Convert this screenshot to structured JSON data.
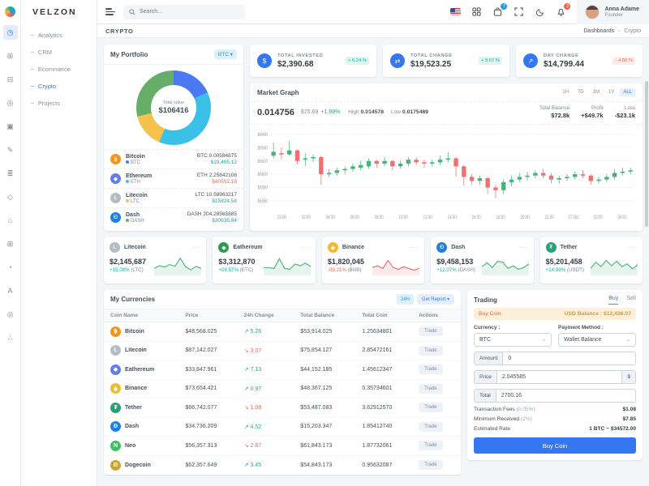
{
  "brand": {
    "name": "VELZON"
  },
  "topbar": {
    "search_placeholder": "Search...",
    "cart_badge": "7",
    "bell_badge": "3",
    "user": {
      "name": "Anna Adame",
      "role": "Founder"
    }
  },
  "sidebar": {
    "rail_icons": [
      {
        "name": "dashboards-icon",
        "glyph": "◷",
        "active": true
      },
      {
        "name": "apps-icon",
        "glyph": "⊞",
        "active": false
      },
      {
        "name": "layouts-icon",
        "glyph": "⊟",
        "active": false
      },
      {
        "name": "authentication-icon",
        "glyph": "◎",
        "active": false
      },
      {
        "name": "pages-icon",
        "glyph": "▣",
        "active": false
      },
      {
        "name": "forms-icon",
        "glyph": "✎",
        "active": false
      },
      {
        "name": "components-icon",
        "glyph": "≣",
        "active": false
      },
      {
        "name": "security-icon",
        "glyph": "◇",
        "active": false
      },
      {
        "name": "landing-icon",
        "glyph": "⌂",
        "active": false
      },
      {
        "name": "tables-icon",
        "glyph": "⊞",
        "active": false
      },
      {
        "name": "charts-icon",
        "glyph": "◔",
        "active": false
      },
      {
        "name": "typography-icon",
        "glyph": "A",
        "active": false
      },
      {
        "name": "settings-icon",
        "glyph": "◎",
        "active": false
      },
      {
        "name": "share-icon",
        "glyph": "∴",
        "active": false
      }
    ],
    "items": [
      {
        "label": "Analytics",
        "active": false
      },
      {
        "label": "CRM",
        "active": false
      },
      {
        "label": "Ecommerce",
        "active": false
      },
      {
        "label": "Crypto",
        "active": true
      },
      {
        "label": "Projects",
        "active": false
      }
    ]
  },
  "breadcrumb": {
    "title": "CRYPTO",
    "path": [
      "Dashboards",
      "Crypto"
    ]
  },
  "portfolio": {
    "title": "My Portfolio",
    "currency_selector": "BTC",
    "total_label": "Total value",
    "total_value": "$106416",
    "donut": {
      "colors": [
        "#4b79f1",
        "#3bc0e8",
        "#f7c24b",
        "#66ad68"
      ],
      "segments": [
        {
          "name": "Bitcoin",
          "pct": 18.2
        },
        {
          "name": "Ethereum",
          "pct": 38.1
        },
        {
          "name": "Litecoin",
          "pct": 14.9
        },
        {
          "name": "Dash",
          "pct": 28.8
        }
      ]
    },
    "coins": [
      {
        "name": "Bitcoin",
        "ticker": "BTC",
        "amount": "BTC 0.00584875",
        "value": "$19,405.12",
        "dir": "up",
        "icon": "฿",
        "icon_color": "#f7931a",
        "dot": "#4b79f1"
      },
      {
        "name": "Ethereum",
        "ticker": "ETH",
        "amount": "ETH 2.25842108",
        "value": "$40552.18",
        "dir": "down",
        "icon": "◆",
        "icon_color": "#627eea",
        "dot": "#3bc0e8"
      },
      {
        "name": "Litecoin",
        "ticker": "LTC",
        "amount": "LTC 10.58963217",
        "value": "$15824.58",
        "dir": "up",
        "icon": "Ł",
        "icon_color": "#b5bdc4",
        "dot": "#f7c24b"
      },
      {
        "name": "Dash",
        "ticker": "DASH",
        "amount": "DASH 204.28565885",
        "value": "$30635.84",
        "dir": "up",
        "icon": "Đ",
        "icon_color": "#1f7fe0",
        "dot": "#66ad68"
      }
    ]
  },
  "stats": [
    {
      "label": "TOTAL INVESTED",
      "value": "$2,390.68",
      "change": "+ 6.24 %",
      "dir": "up",
      "icon": "$"
    },
    {
      "label": "TOTAL CHANGE",
      "value": "$19,523.25",
      "change": "+ 3.67 %",
      "dir": "up",
      "icon": "⇄"
    },
    {
      "label": "DAY CHANGE",
      "value": "$14,799.44",
      "change": "- 4.80 %",
      "dir": "down",
      "icon": "↗"
    }
  ],
  "market": {
    "title": "Market Graph",
    "ranges": [
      "1H",
      "7D",
      "1M",
      "1Y",
      "ALL"
    ],
    "active_range": "ALL",
    "price": "0.014756",
    "usd": "$75.69",
    "change": "+1.99%",
    "high_label": "High",
    "high": "0.014578",
    "low_label": "Low",
    "low": "0.0175489",
    "total_balance_label": "Total Balance",
    "total_balance": "$72.8k",
    "profit_label": "Profit",
    "profit": "+$49.7k",
    "loss_label": "Loss",
    "loss": "-$23.1k"
  },
  "chart_data": {
    "type": "candlestick",
    "title": "Market Graph",
    "up_color": "#45b37a",
    "down_color": "#f07070",
    "ylim": [
      6550,
      6665
    ],
    "y_ticks": [
      6660,
      6640,
      6620,
      6600,
      6580,
      6560
    ],
    "y_tick_labels": [
      "$6660",
      "$6640",
      "$6620",
      "$6600",
      "$6580",
      "$6560"
    ],
    "x_ticks": [
      "23:00",
      "02:00",
      "04:00",
      "06:00",
      "08:00",
      "10:00",
      "12:00",
      "14:00",
      "16:00",
      "18:00",
      "20:00",
      "22:00",
      "07 Oct",
      "02:00",
      "04:00"
    ],
    "candles_ohlc": [
      [
        6628,
        6648,
        6624,
        6634
      ],
      [
        6632,
        6640,
        6622,
        6630
      ],
      [
        6630,
        6650,
        6628,
        6636
      ],
      [
        6636,
        6638,
        6615,
        6620
      ],
      [
        6622,
        6632,
        6612,
        6624
      ],
      [
        6624,
        6630,
        6618,
        6626
      ],
      [
        6626,
        6628,
        6584,
        6600
      ],
      [
        6600,
        6608,
        6596,
        6602
      ],
      [
        6602,
        6610,
        6598,
        6606
      ],
      [
        6606,
        6612,
        6600,
        6608
      ],
      [
        6608,
        6616,
        6604,
        6612
      ],
      [
        6610,
        6620,
        6606,
        6614
      ],
      [
        6612,
        6624,
        6608,
        6620
      ],
      [
        6620,
        6622,
        6610,
        6616
      ],
      [
        6616,
        6626,
        6612,
        6620
      ],
      [
        6620,
        6622,
        6606,
        6612
      ],
      [
        6612,
        6620,
        6608,
        6616
      ],
      [
        6616,
        6626,
        6612,
        6622
      ],
      [
        6622,
        6626,
        6614,
        6618
      ],
      [
        6618,
        6622,
        6610,
        6616
      ],
      [
        6616,
        6622,
        6612,
        6618
      ],
      [
        6618,
        6628,
        6614,
        6622
      ],
      [
        6622,
        6634,
        6618,
        6624
      ],
      [
        6624,
        6626,
        6596,
        6612
      ],
      [
        6612,
        6614,
        6582,
        6596
      ],
      [
        6596,
        6600,
        6584,
        6590
      ],
      [
        6590,
        6598,
        6584,
        6594
      ],
      [
        6594,
        6596,
        6570,
        6580
      ],
      [
        6580,
        6584,
        6564,
        6576
      ],
      [
        6576,
        6592,
        6570,
        6588
      ],
      [
        6588,
        6598,
        6582,
        6592
      ],
      [
        6592,
        6602,
        6588,
        6596
      ],
      [
        6596,
        6604,
        6590,
        6598
      ],
      [
        6598,
        6606,
        6594,
        6602
      ],
      [
        6602,
        6608,
        6594,
        6598
      ],
      [
        6598,
        6602,
        6586,
        6592
      ],
      [
        6592,
        6598,
        6586,
        6594
      ],
      [
        6594,
        6600,
        6590,
        6596
      ],
      [
        6596,
        6604,
        6592,
        6600
      ],
      [
        6600,
        6606,
        6594,
        6598
      ],
      [
        6598,
        6600,
        6584,
        6590
      ],
      [
        6590,
        6596,
        6586,
        6592
      ],
      [
        6592,
        6600,
        6588,
        6596
      ],
      [
        6596,
        6608,
        6592,
        6602
      ],
      [
        6602,
        6610,
        6598,
        6604
      ],
      [
        6604,
        6610,
        6600,
        6606
      ]
    ]
  },
  "coin_cards": [
    {
      "name": "Litecoin",
      "value": "$2,145,687",
      "change": "+15.08%",
      "ticker": "(LTC)",
      "dir": "up",
      "icon": "Ł",
      "icon_color": "#b5bdc4",
      "spark": [
        30,
        45,
        38,
        52,
        42,
        88,
        40,
        22,
        42,
        30
      ]
    },
    {
      "name": "Eathereum",
      "value": "$3,312,870",
      "change": "+08.57%",
      "ticker": "(ETC)",
      "dir": "up",
      "icon": "◆",
      "icon_color": "#2d9a4f",
      "spark": [
        35,
        35,
        30,
        85,
        30,
        25,
        55,
        45,
        60,
        40
      ]
    },
    {
      "name": "Binance",
      "value": "$1,820,045",
      "change": "-09.21%",
      "ticker": "(BNB)",
      "dir": "down",
      "icon": "◆",
      "icon_color": "#f3ba2f",
      "spark": [
        35,
        45,
        30,
        75,
        35,
        25,
        40,
        30,
        20,
        32
      ]
    },
    {
      "name": "Dash",
      "value": "$9,458,153",
      "change": "+12.07%",
      "ticker": "(DASH)",
      "dir": "up",
      "icon": "Đ",
      "icon_color": "#1f7fe0",
      "spark": [
        40,
        62,
        35,
        70,
        65,
        30,
        45,
        25,
        35,
        55
      ]
    },
    {
      "name": "Tether",
      "value": "$5,201,458",
      "change": "+14.99%",
      "ticker": "(USDT)",
      "dir": "up",
      "icon": "₮",
      "icon_color": "#26a17b",
      "spark": [
        30,
        65,
        40,
        75,
        45,
        70,
        40,
        55,
        28,
        50
      ]
    }
  ],
  "currencies": {
    "title": "My Currencies",
    "range_button": "24H",
    "report_button": "Get Report",
    "columns": [
      "Coin Name",
      "Price",
      "24h Change",
      "Total Balance",
      "Total Coin",
      "Actions"
    ],
    "rows": [
      {
        "name": "Bitcoin",
        "icon": "฿",
        "color": "#f7931a",
        "price": "$48,568.025",
        "change": "5.26",
        "dir": "up",
        "balance": "$53,914.025",
        "coin": "1.25634801",
        "action": "Trade"
      },
      {
        "name": "Litecoin",
        "icon": "Ł",
        "color": "#b5bdc4",
        "price": "$87,142.027",
        "change": "3.07",
        "dir": "down",
        "balance": "$75,854.127",
        "coin": "2.85472161",
        "action": "Trade"
      },
      {
        "name": "Eathereum",
        "icon": "◆",
        "color": "#627eea",
        "price": "$33,847.961",
        "change": "7.13",
        "dir": "up",
        "balance": "$44,152.185",
        "coin": "1.45612347",
        "action": "Trade"
      },
      {
        "name": "Binance",
        "icon": "◆",
        "color": "#f3ba2f",
        "price": "$73,654.421",
        "change": "0.97",
        "dir": "up",
        "balance": "$48,367.125",
        "coin": "0.35734601",
        "action": "Trade"
      },
      {
        "name": "Tether",
        "icon": "₮",
        "color": "#26a17b",
        "price": "$66,742.077",
        "change": "1.08",
        "dir": "down",
        "balance": "$53,487.083",
        "coin": "3.62912570",
        "action": "Trade"
      },
      {
        "name": "Dash",
        "icon": "Đ",
        "color": "#1f7fe0",
        "price": "$34,736.209",
        "change": "4.52",
        "dir": "up",
        "balance": "$15,203.347",
        "coin": "1.85412740",
        "action": "Trade"
      },
      {
        "name": "Neo",
        "icon": "N",
        "color": "#41bf64",
        "price": "$56,357.313",
        "change": "2.87",
        "dir": "down",
        "balance": "$61,843.173",
        "coin": "1.87732061",
        "action": "Trade"
      },
      {
        "name": "Dogecoin",
        "icon": "Ð",
        "color": "#c9a633",
        "price": "$62,357.649",
        "change": "3.45",
        "dir": "up",
        "balance": "$54,843.173",
        "coin": "0.95632087",
        "action": "Trade"
      }
    ]
  },
  "trading": {
    "title": "Trading",
    "tabs": [
      "Buy",
      "Sell"
    ],
    "active_tab": "Buy",
    "banner_left": "Buy Coin",
    "banner_right_label": "USD Balance :",
    "banner_right_value": "$12,426.07",
    "currency_label": "Currency :",
    "currency_value": "BTC",
    "payment_label": "Payment Method :",
    "payment_value": "Wallet Balance",
    "amount_label": "Amount",
    "amount_value": "0",
    "price_label": "Price",
    "price_value": "2.045585",
    "price_addon": "$",
    "total_label": "Total",
    "total_value": "2700.16",
    "fees_label": "Transaction Fees",
    "fees_note": "(0.05%)",
    "fees_value": "$1.08",
    "min_label": "Minimum Received",
    "min_note": "(2%)",
    "min_value": "$7.85",
    "rate_label": "Estimated Rate",
    "rate_value": "1 BTC ~ $34572.00",
    "submit_label": "Buy Coin"
  }
}
